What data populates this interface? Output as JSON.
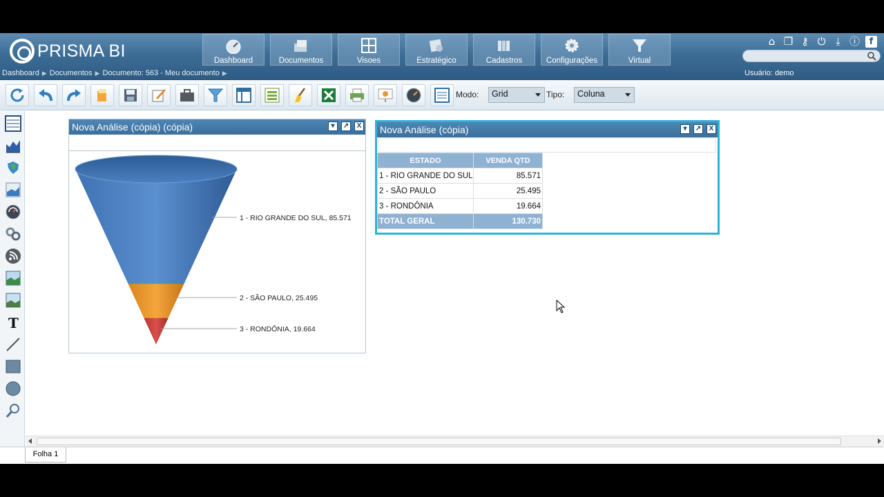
{
  "app": {
    "brand": "PRISMA BI",
    "nav_tabs": [
      {
        "label": "Dashboard",
        "icon": "dashboard-icon"
      },
      {
        "label": "Documentos",
        "icon": "documents-icon"
      },
      {
        "label": "Visoes",
        "icon": "views-icon"
      },
      {
        "label": "Estratégico",
        "icon": "strategic-icon"
      },
      {
        "label": "Cadastros",
        "icon": "registry-icon"
      },
      {
        "label": "Configurações",
        "icon": "settings-icon"
      },
      {
        "label": "Virtual",
        "icon": "virtual-icon"
      }
    ],
    "top_icons": [
      "home-icon",
      "windows-icon",
      "key-icon",
      "power-icon",
      "download-icon",
      "info-icon",
      "facebook-icon"
    ],
    "search": {
      "value": ""
    },
    "breadcrumb": [
      "Dashboard",
      "Documentos",
      "Documento: 563 - Meu documento"
    ],
    "user_label": "Usuário: demo"
  },
  "toolbar": {
    "buttons": [
      "refresh-icon",
      "undo-icon",
      "redo-icon",
      "open-icon",
      "save-icon",
      "edit-icon",
      "briefcase-icon",
      "filter-icon",
      "layout-icon",
      "list-icon",
      "clean-icon",
      "excel-icon",
      "print-icon",
      "presentation-icon",
      "gauge-icon",
      "grid-view-icon"
    ],
    "mode_label": "Modo:",
    "mode_value": "Grid",
    "type_label": "Tipo:",
    "type_value": "Coluna"
  },
  "left_tools": [
    "table-tool-icon",
    "chart-tool-icon",
    "map-tool-icon",
    "area-chart-tool-icon",
    "gauge-tool-icon",
    "link-tool-icon",
    "rss-tool-icon",
    "image-tool-icon",
    "image2-tool-icon",
    "text-tool-icon",
    "line-tool-icon",
    "rectangle-tool-icon",
    "circle-tool-icon",
    "zoom-tool-icon"
  ],
  "funnel_panel": {
    "title": "Nova Análise (cópia) (cópia)",
    "chart_data": {
      "type": "funnel",
      "categories": [
        "1 - RIO GRANDE DO SUL",
        "2 - SÃO PAULO",
        "3 - RONDÔNIA"
      ],
      "values": [
        85.571,
        25.495,
        19.664
      ],
      "labels": [
        "1 - RIO GRANDE DO SUL, 85.571",
        "2 - SÃO PAULO, 25.495",
        "3 - RONDÔNIA, 19.664"
      ],
      "colors": [
        "#4a7fc1",
        "#f09a2a",
        "#d0433e"
      ]
    }
  },
  "table_panel": {
    "title": "Nova Análise (cópia)",
    "columns": [
      "ESTADO",
      "VENDA QTD"
    ],
    "rows": [
      [
        "1 - RIO GRANDE DO SUL",
        "85.571"
      ],
      [
        "2 - SÃO PAULO",
        "25.495"
      ],
      [
        "3 - RONDÔNIA",
        "19.664"
      ]
    ],
    "total": [
      "TOTAL GERAL",
      "130.730"
    ]
  },
  "sheets": [
    "Folha 1"
  ],
  "colors": {
    "header": "#3d6d96",
    "accent": "#2bb3d7",
    "table_header": "#8fb2d3"
  }
}
